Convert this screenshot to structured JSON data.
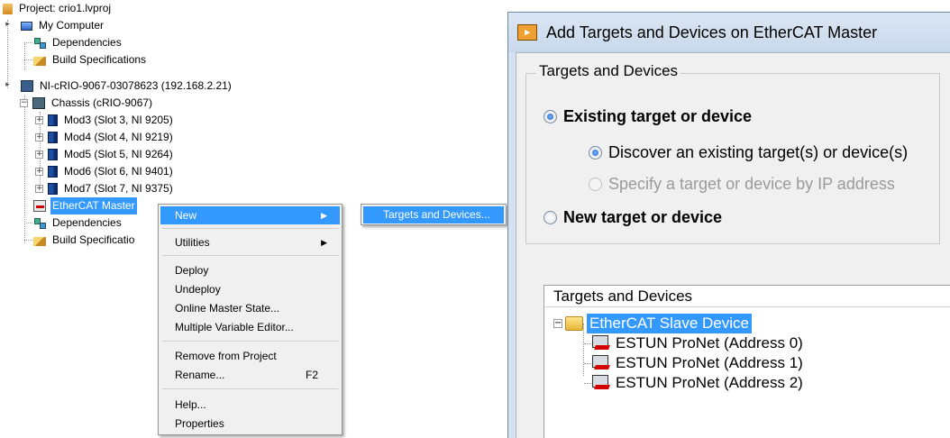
{
  "tree": {
    "project": "Project: crio1.lvproj",
    "my_computer": "My Computer",
    "dependencies": "Dependencies",
    "build_specs": "Build Specifications",
    "target": "NI-cRIO-9067-03078623 (192.168.2.21)",
    "chassis": "Chassis (cRIO-9067)",
    "modules": [
      "Mod3 (Slot 3, NI 9205)",
      "Mod4 (Slot 4, NI 9219)",
      "Mod5 (Slot 5, NI 9264)",
      "Mod6 (Slot 6, NI 9401)",
      "Mod7 (Slot 7, NI 9375)"
    ],
    "ethercat_master": "EtherCAT Master",
    "target_dependencies": "Dependencies",
    "target_build_specs": "Build Specificatio"
  },
  "context_menu": {
    "new": "New",
    "utilities": "Utilities",
    "deploy": "Deploy",
    "undeploy": "Undeploy",
    "online_master_state": "Online Master State...",
    "multiple_variable_editor": "Multiple Variable Editor...",
    "remove_from_project": "Remove from Project",
    "rename": "Rename...",
    "rename_shortcut": "F2",
    "help": "Help...",
    "properties": "Properties"
  },
  "submenu": {
    "targets_and_devices": "Targets and Devices..."
  },
  "dialog": {
    "title": "Add Targets and Devices on EtherCAT Master",
    "group_title": "Targets and Devices",
    "existing": "Existing target or device",
    "discover": "Discover an existing target(s) or device(s)",
    "specify_ip": "Specify a target or device by IP address",
    "new_target": "New target or device",
    "list_header": "Targets and Devices",
    "slave_folder": "EtherCAT Slave Device",
    "devices": [
      "ESTUN ProNet (Address 0)",
      "ESTUN ProNet (Address 1)",
      "ESTUN ProNet (Address 2)"
    ]
  }
}
